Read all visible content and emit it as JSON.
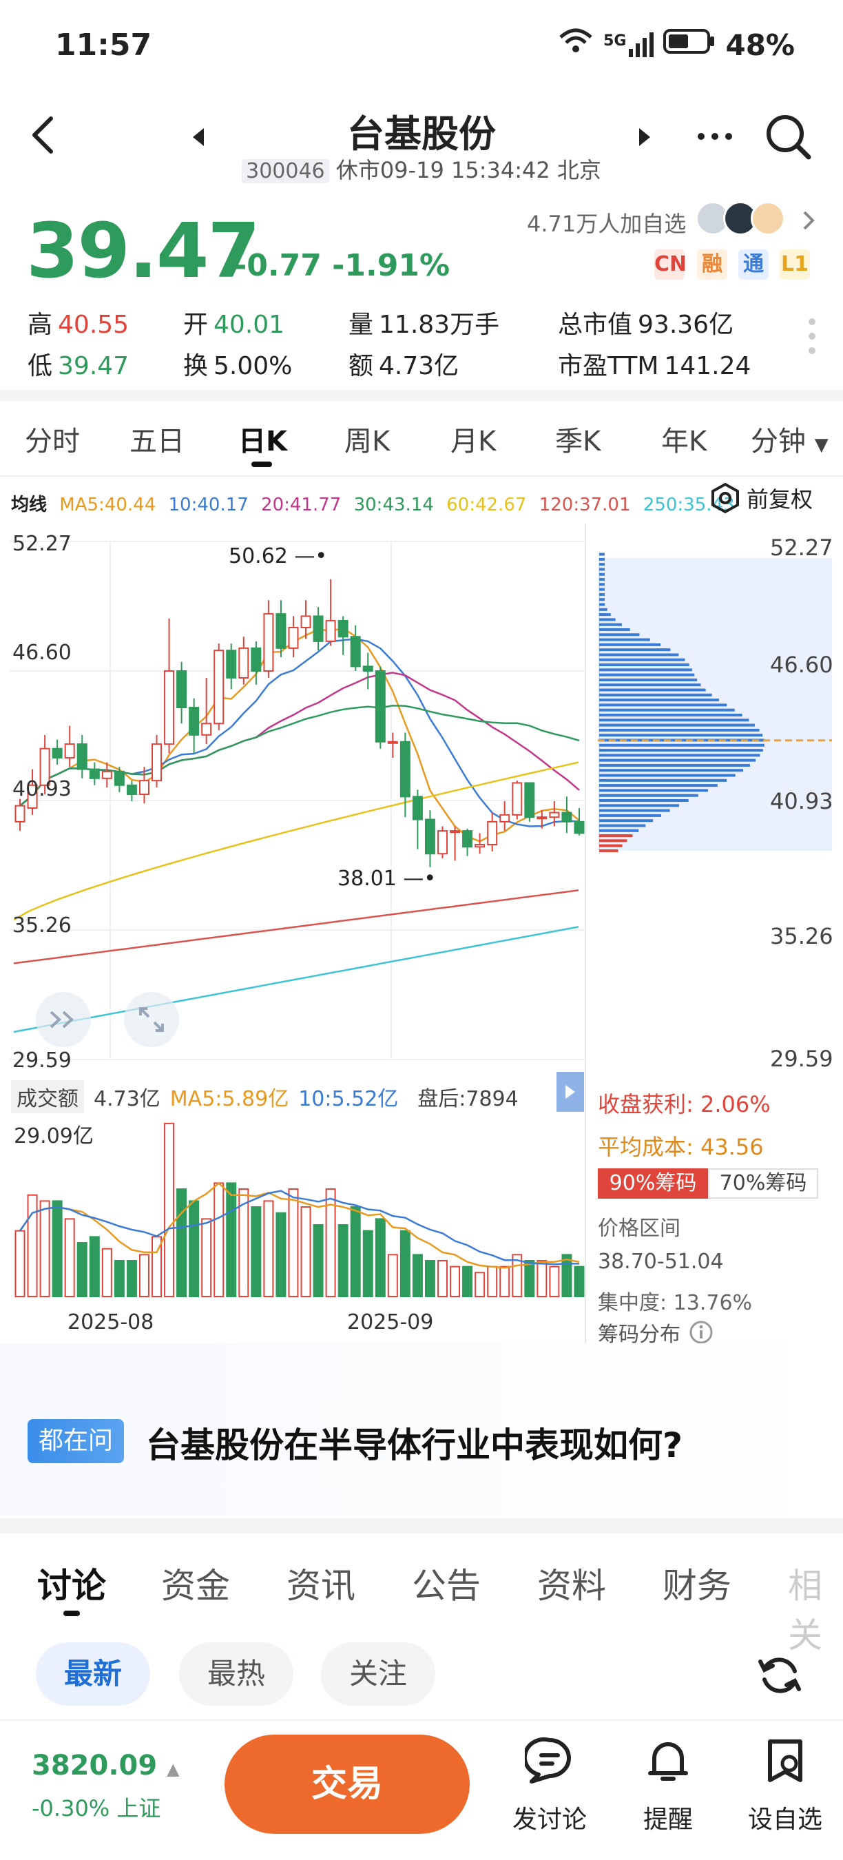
{
  "status": {
    "time": "11:57",
    "network": "5G",
    "battery": "48%"
  },
  "header": {
    "stock_name": "台基股份",
    "code": "300046",
    "market_status": "休市09-19 15:34:42 北京"
  },
  "quote": {
    "price": "39.47",
    "change": "-0.77 -1.91%",
    "followers": "4.71万人加自选",
    "tags": [
      "CN",
      "融",
      "通",
      "L1"
    ],
    "stats": {
      "high_label": "高",
      "high": "40.55",
      "open_label": "开",
      "open": "40.01",
      "volume_label": "量",
      "volume": "11.83万手",
      "mcap_label": "总市值",
      "mcap": "93.36亿",
      "low_label": "低",
      "low": "39.47",
      "turnover_label": "换",
      "turnover": "5.00%",
      "amount_label": "额",
      "amount": "4.73亿",
      "pe_label": "市盈TTM",
      "pe": "141.24"
    }
  },
  "period_tabs": [
    "分时",
    "五日",
    "日K",
    "周K",
    "月K",
    "季K",
    "年K",
    "分钟"
  ],
  "active_period": "日K",
  "ma": {
    "label": "均线",
    "items": [
      {
        "text": "MA5:40.44",
        "color": "#e79a1f"
      },
      {
        "text": "10:40.17",
        "color": "#3a7bd5"
      },
      {
        "text": "20:41.77",
        "color": "#c2378a"
      },
      {
        "text": "30:43.14",
        "color": "#2e9a5c"
      },
      {
        "text": "60:42.67",
        "color": "#e8c21c"
      },
      {
        "text": "120:37.01",
        "color": "#d9534f"
      },
      {
        "text": "250:35.43",
        "color": "#3cc3d6"
      }
    ],
    "adjust": "前复权"
  },
  "price_axis": {
    "left": [
      "52.27",
      "46.60",
      "40.93",
      "35.26",
      "29.59"
    ],
    "right": [
      "52.27",
      "46.60",
      "40.93",
      "35.26",
      "29.59"
    ]
  },
  "annotations": {
    "high": "50.62",
    "low": "38.01"
  },
  "volume": {
    "label": "成交额",
    "value": "4.73亿",
    "ma5": "MA5:5.89亿",
    "ma10": "10:5.52亿",
    "after_hours": "盘后:7894",
    "max": "29.09亿"
  },
  "x_axis": [
    "2025-08",
    "2025-09"
  ],
  "chip": {
    "profit_label": "收盘获利:",
    "profit": "2.06%",
    "cost_label": "平均成本:",
    "cost": "43.56",
    "tab_90": "90%筹码",
    "tab_70": "70%筹码",
    "range_label": "价格区间",
    "range": "38.70-51.04",
    "concentration": "集中度: 13.76%",
    "dist_label": "筹码分布"
  },
  "question": {
    "badge": "都在问",
    "text": "台基股份在半导体行业中表现如何?"
  },
  "content_tabs": [
    "讨论",
    "资金",
    "资讯",
    "公告",
    "资料",
    "财务",
    "相关"
  ],
  "filter_pills": [
    "最新",
    "最热",
    "关注"
  ],
  "bottom": {
    "index_value": "3820.09",
    "index_change": "-0.30% 上证",
    "trade": "交易",
    "actions": [
      "发讨论",
      "提醒",
      "设自选"
    ]
  },
  "chart_data": {
    "type": "candlestick",
    "y_range": [
      29.59,
      52.27
    ],
    "x_labels": [
      "2025-08",
      "2025-09"
    ],
    "candles_approx": [
      [
        40.0,
        40.7,
        39.6,
        41.0
      ],
      [
        40.6,
        41.6,
        40.3,
        42.3
      ],
      [
        41.6,
        43.2,
        41.2,
        43.8
      ],
      [
        43.2,
        42.8,
        42.5,
        43.6
      ],
      [
        42.8,
        43.4,
        42.4,
        44.2
      ],
      [
        43.4,
        42.3,
        41.9,
        43.8
      ],
      [
        42.3,
        41.9,
        41.6,
        42.6
      ],
      [
        41.9,
        42.2,
        41.5,
        42.6
      ],
      [
        42.2,
        41.6,
        41.3,
        42.4
      ],
      [
        41.6,
        41.2,
        40.9,
        41.8
      ],
      [
        41.2,
        41.8,
        40.8,
        42.4
      ],
      [
        41.8,
        43.4,
        41.5,
        43.8
      ],
      [
        43.4,
        46.6,
        43.0,
        48.9
      ],
      [
        46.6,
        45.0,
        44.3,
        47.0
      ],
      [
        45.0,
        43.8,
        43.0,
        45.4
      ],
      [
        43.8,
        44.3,
        43.4,
        46.3
      ],
      [
        44.3,
        47.5,
        44.0,
        47.8
      ],
      [
        47.5,
        46.3,
        45.8,
        47.8
      ],
      [
        46.3,
        47.6,
        46.0,
        48.1
      ],
      [
        47.6,
        46.6,
        46.0,
        47.9
      ],
      [
        46.6,
        49.1,
        46.3,
        49.7
      ],
      [
        49.1,
        47.6,
        47.2,
        49.7
      ],
      [
        47.6,
        48.5,
        47.2,
        49.0
      ],
      [
        48.5,
        49.0,
        48.0,
        49.7
      ],
      [
        49.0,
        47.9,
        47.5,
        49.4
      ],
      [
        47.9,
        48.8,
        47.7,
        50.62
      ],
      [
        48.8,
        48.1,
        47.3,
        49.0
      ],
      [
        48.1,
        46.8,
        46.6,
        48.6
      ],
      [
        46.8,
        46.6,
        45.8,
        47.4
      ],
      [
        46.6,
        43.5,
        43.2,
        46.8
      ],
      [
        43.5,
        43.5,
        42.8,
        43.9
      ],
      [
        43.5,
        41.1,
        40.2,
        43.9
      ],
      [
        41.1,
        40.1,
        38.8,
        41.4
      ],
      [
        40.1,
        38.6,
        38.01,
        40.5
      ],
      [
        38.6,
        39.6,
        38.4,
        39.8
      ],
      [
        39.6,
        39.6,
        38.3,
        39.8
      ],
      [
        39.6,
        38.9,
        38.5,
        39.7
      ],
      [
        38.9,
        39.0,
        38.6,
        39.5
      ],
      [
        39.0,
        40.0,
        38.7,
        40.4
      ],
      [
        40.0,
        40.3,
        39.6,
        40.9
      ],
      [
        40.3,
        41.7,
        40.1,
        41.8
      ],
      [
        41.7,
        40.2,
        40.0,
        41.2
      ],
      [
        40.2,
        40.2,
        39.7,
        40.5
      ],
      [
        40.2,
        40.4,
        39.8,
        40.9
      ],
      [
        40.4,
        40.0,
        39.5,
        41.1
      ],
      [
        40.0,
        39.5,
        39.4,
        40.6
      ]
    ]
  }
}
